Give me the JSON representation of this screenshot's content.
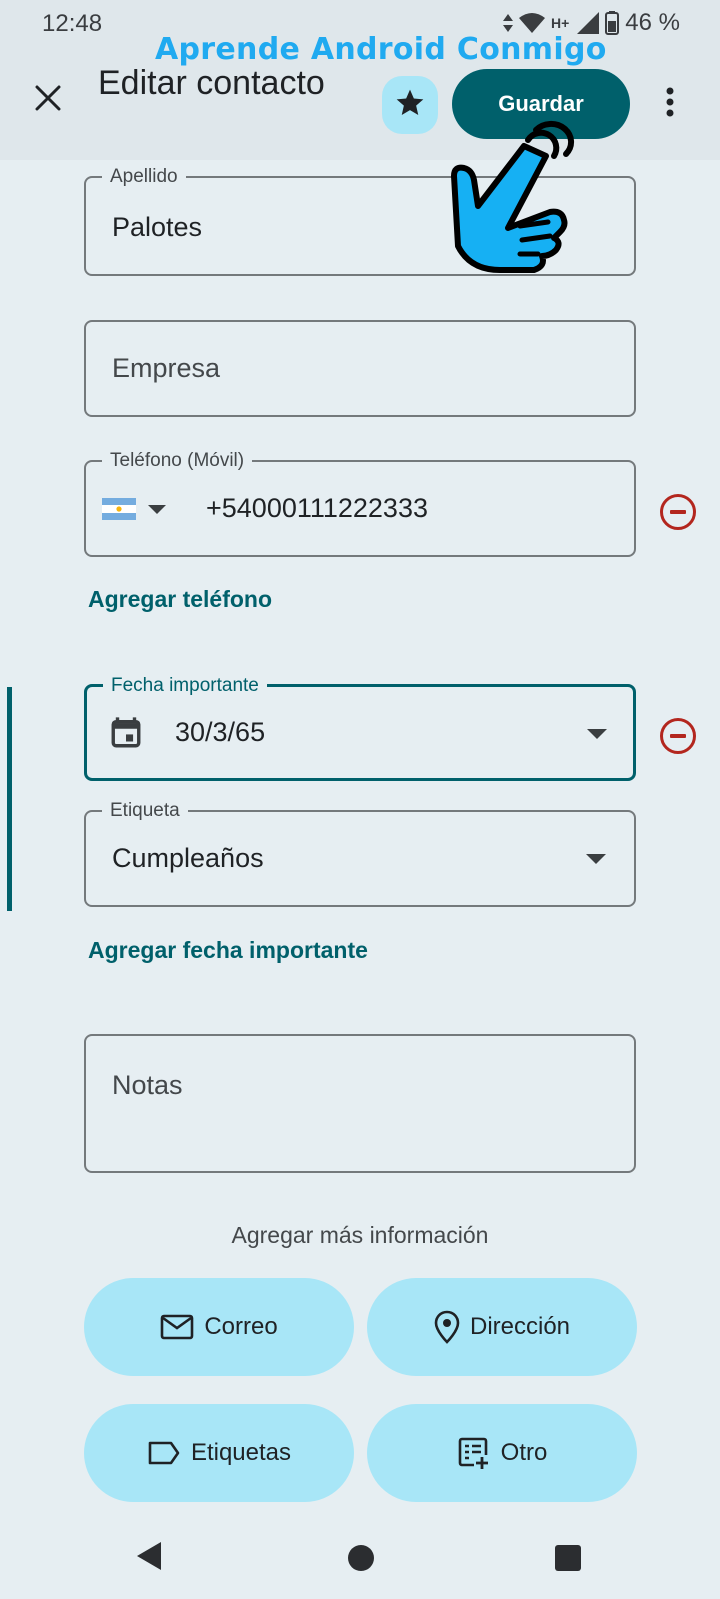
{
  "status_bar": {
    "time": "12:48",
    "network": "H+",
    "battery": "46 %"
  },
  "watermark": "Aprende Android Conmigo",
  "app_bar": {
    "title": "Editar contacto",
    "save_label": "Guardar",
    "icons": [
      "close-icon",
      "star-icon",
      "more-vert-icon"
    ]
  },
  "fields": {
    "last_name": {
      "label": "Apellido",
      "value": "Palotes"
    },
    "company": {
      "placeholder": "Empresa"
    },
    "phone": {
      "label": "Teléfono (Móvil)",
      "value": "+54000111222333",
      "flag": "🇦🇷"
    },
    "add_phone": "Agregar teléfono",
    "important_date": {
      "label": "Fecha importante",
      "value": "30/3/65"
    },
    "tag": {
      "label": "Etiqueta",
      "value": "Cumpleaños"
    },
    "add_date": "Agregar fecha importante",
    "notes": {
      "placeholder": "Notas"
    }
  },
  "more_info": {
    "title": "Agregar más información",
    "chips": [
      {
        "label": "Correo",
        "icon": "mail-icon"
      },
      {
        "label": "Dirección",
        "icon": "location-pin-icon"
      },
      {
        "label": "Etiquetas",
        "icon": "label-icon"
      },
      {
        "label": "Otro",
        "icon": "add-list-icon"
      }
    ]
  },
  "colors": {
    "primary": "#00606b",
    "chip_bg": "#a8e6f7",
    "error": "#b3261e",
    "background": "#e6eef2",
    "watermark": "#20aaf0"
  }
}
